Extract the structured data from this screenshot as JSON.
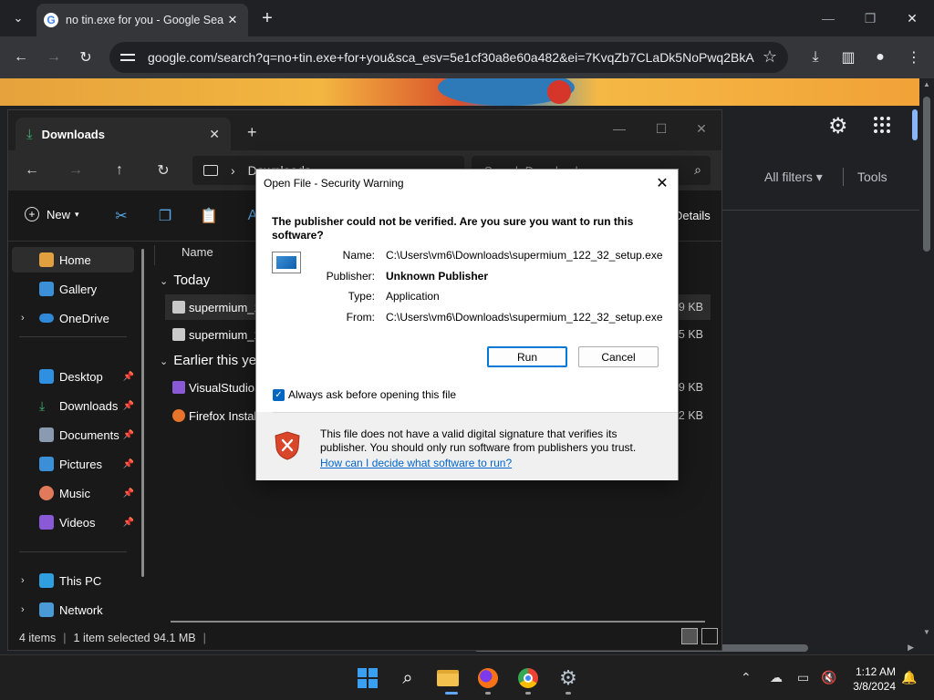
{
  "chrome": {
    "tab_title": "no tin.exe for you - Google Sea",
    "url": "google.com/search?q=no+tin.exe+for+you&sca_esv=5e1cf30a8e60a482&ei=7KvqZb7CLaDk5NoPwq2BkA..."
  },
  "google": {
    "all_filters": "All filters ▾",
    "tools": "Tools"
  },
  "explorer": {
    "tab_title": "Downloads",
    "address": "Downloads",
    "search_placeholder": "Search Downloads",
    "new_label": "New",
    "details_label": "Details",
    "sidebar": {
      "home": "Home",
      "gallery": "Gallery",
      "onedrive": "OneDrive",
      "desktop": "Desktop",
      "downloads": "Downloads",
      "documents": "Documents",
      "pictures": "Pictures",
      "music": "Music",
      "videos": "Videos",
      "this_pc": "This PC",
      "network": "Network"
    },
    "column_name": "Name",
    "group_today": "Today",
    "group_earlier": "Earlier this yea",
    "files": [
      {
        "name": "supermium_12",
        "size": "379 KB"
      },
      {
        "name": "supermium_12",
        "size": "725 KB"
      },
      {
        "name": "VisualStudioSe",
        "size": "909 KB"
      },
      {
        "name": "Firefox Installe",
        "size": "342 KB"
      }
    ],
    "status": {
      "items": "4 items",
      "selected": "1 item selected  94.1 MB"
    }
  },
  "dialog": {
    "title": "Open File - Security Warning",
    "question": "The publisher could not be verified.  Are you sure you want to run this software?",
    "name_label": "Name:",
    "name_value": "C:\\Users\\vm6\\Downloads\\supermium_122_32_setup.exe",
    "publisher_label": "Publisher:",
    "publisher_value": "Unknown Publisher",
    "type_label": "Type:",
    "type_value": "Application",
    "from_label": "From:",
    "from_value": "C:\\Users\\vm6\\Downloads\\supermium_122_32_setup.exe",
    "run_button": "Run",
    "cancel_button": "Cancel",
    "always_ask_label": "Always ask before opening this file",
    "always_ask_checked": true,
    "warning_text": "This file does not have a valid digital signature that verifies its publisher.  You should only run software from publishers you trust.",
    "help_link": "How can I decide what software to run?"
  },
  "taskbar": {
    "time": "1:12 AM",
    "date": "3/8/2024"
  }
}
